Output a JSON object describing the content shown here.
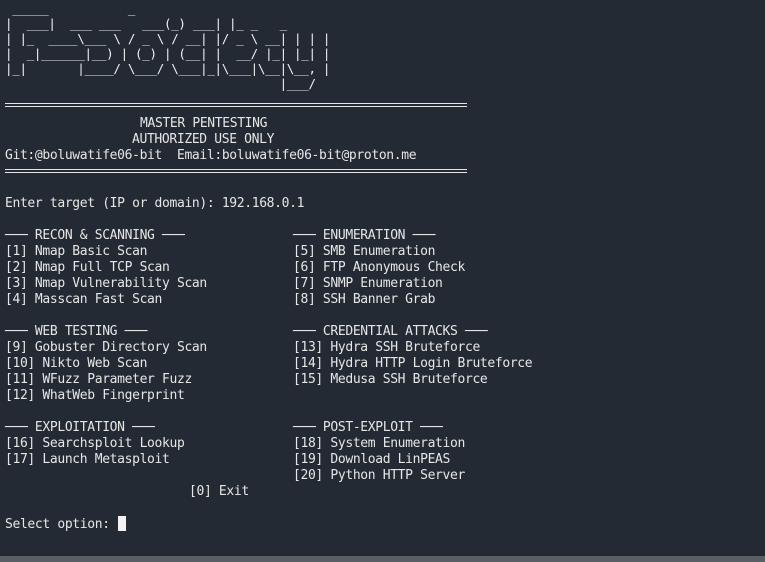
{
  "banner_art": " _____           _\n|  ___|  ___ ___   ___(_) ___| |_ _   _\n| |_  ____\\___ \\ / _ \\ / __| |/ _ \\ __| | | |\n|  _|______|__) | (_) | (__| |  __/ |_| |_| |\n|_|       |____/ \\___/ \\___|_|\\___|\\__|\\__, |\n                                      |___/",
  "header": {
    "title": "MASTER PENTESTING",
    "subtitle": "AUTHORIZED USE ONLY",
    "contact": "Git:@boluwatife06-bit  Email:boluwatife06-bit@proton.me"
  },
  "target_prompt": "Enter target (IP or domain): 192.168.0.1",
  "sections": {
    "recon": {
      "title": "─── RECON & SCANNING ───",
      "items": [
        "[1] Nmap Basic Scan",
        "[2] Nmap Full TCP Scan",
        "[3] Nmap Vulnerability Scan",
        "[4] Masscan Fast Scan"
      ]
    },
    "enumeration": {
      "title": "─── ENUMERATION ───",
      "items": [
        "[5] SMB Enumeration",
        "[6] FTP Anonymous Check",
        "[7] SNMP Enumeration",
        "[8] SSH Banner Grab"
      ]
    },
    "web": {
      "title": "─── WEB TESTING ───",
      "items": [
        "[9] Gobuster Directory Scan",
        "[10] Nikto Web Scan",
        "[11] WFuzz Parameter Fuzz",
        "[12] WhatWeb Fingerprint"
      ]
    },
    "credential": {
      "title": "─── CREDENTIAL ATTACKS ───",
      "items": [
        "[13] Hydra SSH Bruteforce",
        "[14] Hydra HTTP Login Bruteforce",
        "[15] Medusa SSH Bruteforce"
      ]
    },
    "exploitation": {
      "title": "─── EXPLOITATION ───",
      "items": [
        "[16] Searchsploit Lookup",
        "[17] Launch Metasploit"
      ]
    },
    "post_exploit": {
      "title": "─── POST-EXPLOIT ───",
      "items": [
        "[18] System Enumeration",
        "[19] Download LinPEAS",
        "[20] Python HTTP Server"
      ]
    }
  },
  "exit_option": "[0] Exit",
  "select_prompt": "Select option: ",
  "colors": {
    "background": "#242a33",
    "foreground": "#e6e6e6"
  }
}
